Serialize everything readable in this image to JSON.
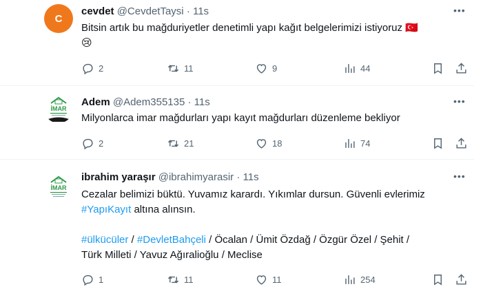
{
  "tweets": [
    {
      "avatar_letter": "C",
      "avatar_color": "#f0781c",
      "name": "cevdet",
      "handle": "@CevdetTaysi",
      "dot": "·",
      "time": "11s",
      "text_line1": "Bitsin artık bu mağduriyetler denetimli yapı kağıt belgelerimizi istiyoruz 🇹🇷",
      "text_line2": "😢",
      "replies": "2",
      "retweets": "11",
      "likes": "9",
      "views": "44"
    },
    {
      "avatar_text": "İMAR",
      "name": "Adem",
      "handle": "@Adem355135",
      "dot": "·",
      "time": "11s",
      "text_line1": "Milyonlarca imar mağdurları yapı kayıt mağdurları düzenleme bekliyor",
      "replies": "2",
      "retweets": "21",
      "likes": "18",
      "views": "74"
    },
    {
      "avatar_text": "İMAR",
      "name": "ibrahim yaraşır",
      "handle": "@ibrahimyarasir",
      "dot": "·",
      "time": "11s",
      "text_line1": "Cezalar belimizi büktü. Yuvamız karardı. Yıkımlar dursun. Güvenli evlerimiz",
      "text_line2_link": "#YapıKayıt",
      "text_line2_rest": " altına alınsın.",
      "tags": [
        "#ülkücüler",
        "#DevletBahçeli"
      ],
      "tags_rest1": " / Öcalan / Ümit Özdağ / Özgür Özel / Şehit /",
      "tags_line2": "Türk Milleti / Yavuz Ağıralioğlu / Meclise",
      "replies": "1",
      "retweets": "11",
      "likes": "11",
      "views": "254"
    }
  ],
  "accent_link_color": "#1d9bf0",
  "muted_color": "#536471"
}
